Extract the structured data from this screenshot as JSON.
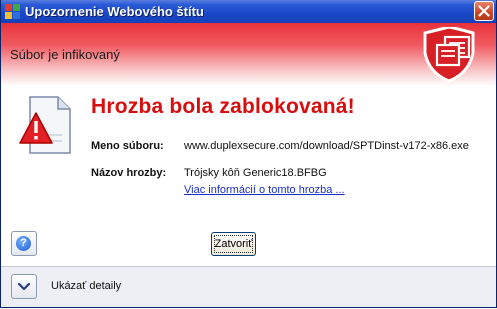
{
  "window": {
    "title": "Upozornenie Webového štítu",
    "icon": "avg-logo-icon",
    "close_icon": "close-icon"
  },
  "header": {
    "status": "Súbor je infikovaný",
    "icon": "shield-icon",
    "color": "#e8323a"
  },
  "main": {
    "title": "Hrozba bola zablokovaná!",
    "title_color": "#d80e0e",
    "icon": "warning-document-icon",
    "file_label": "Meno súboru:",
    "file_value": "www.duplexsecure.com/download/SPTDinst-v172-x86.exe",
    "threat_label": "Názov hrozby:",
    "threat_value": "Trójsky kôň Generic18.BFBG",
    "more_info_link": "Viac informácií o tomto hrozba ..."
  },
  "actions": {
    "help_icon": "help-icon",
    "close_label": "Zatvoriť"
  },
  "footer": {
    "expand_icon": "chevron-down-icon",
    "details_label": "Ukázať detaily"
  }
}
